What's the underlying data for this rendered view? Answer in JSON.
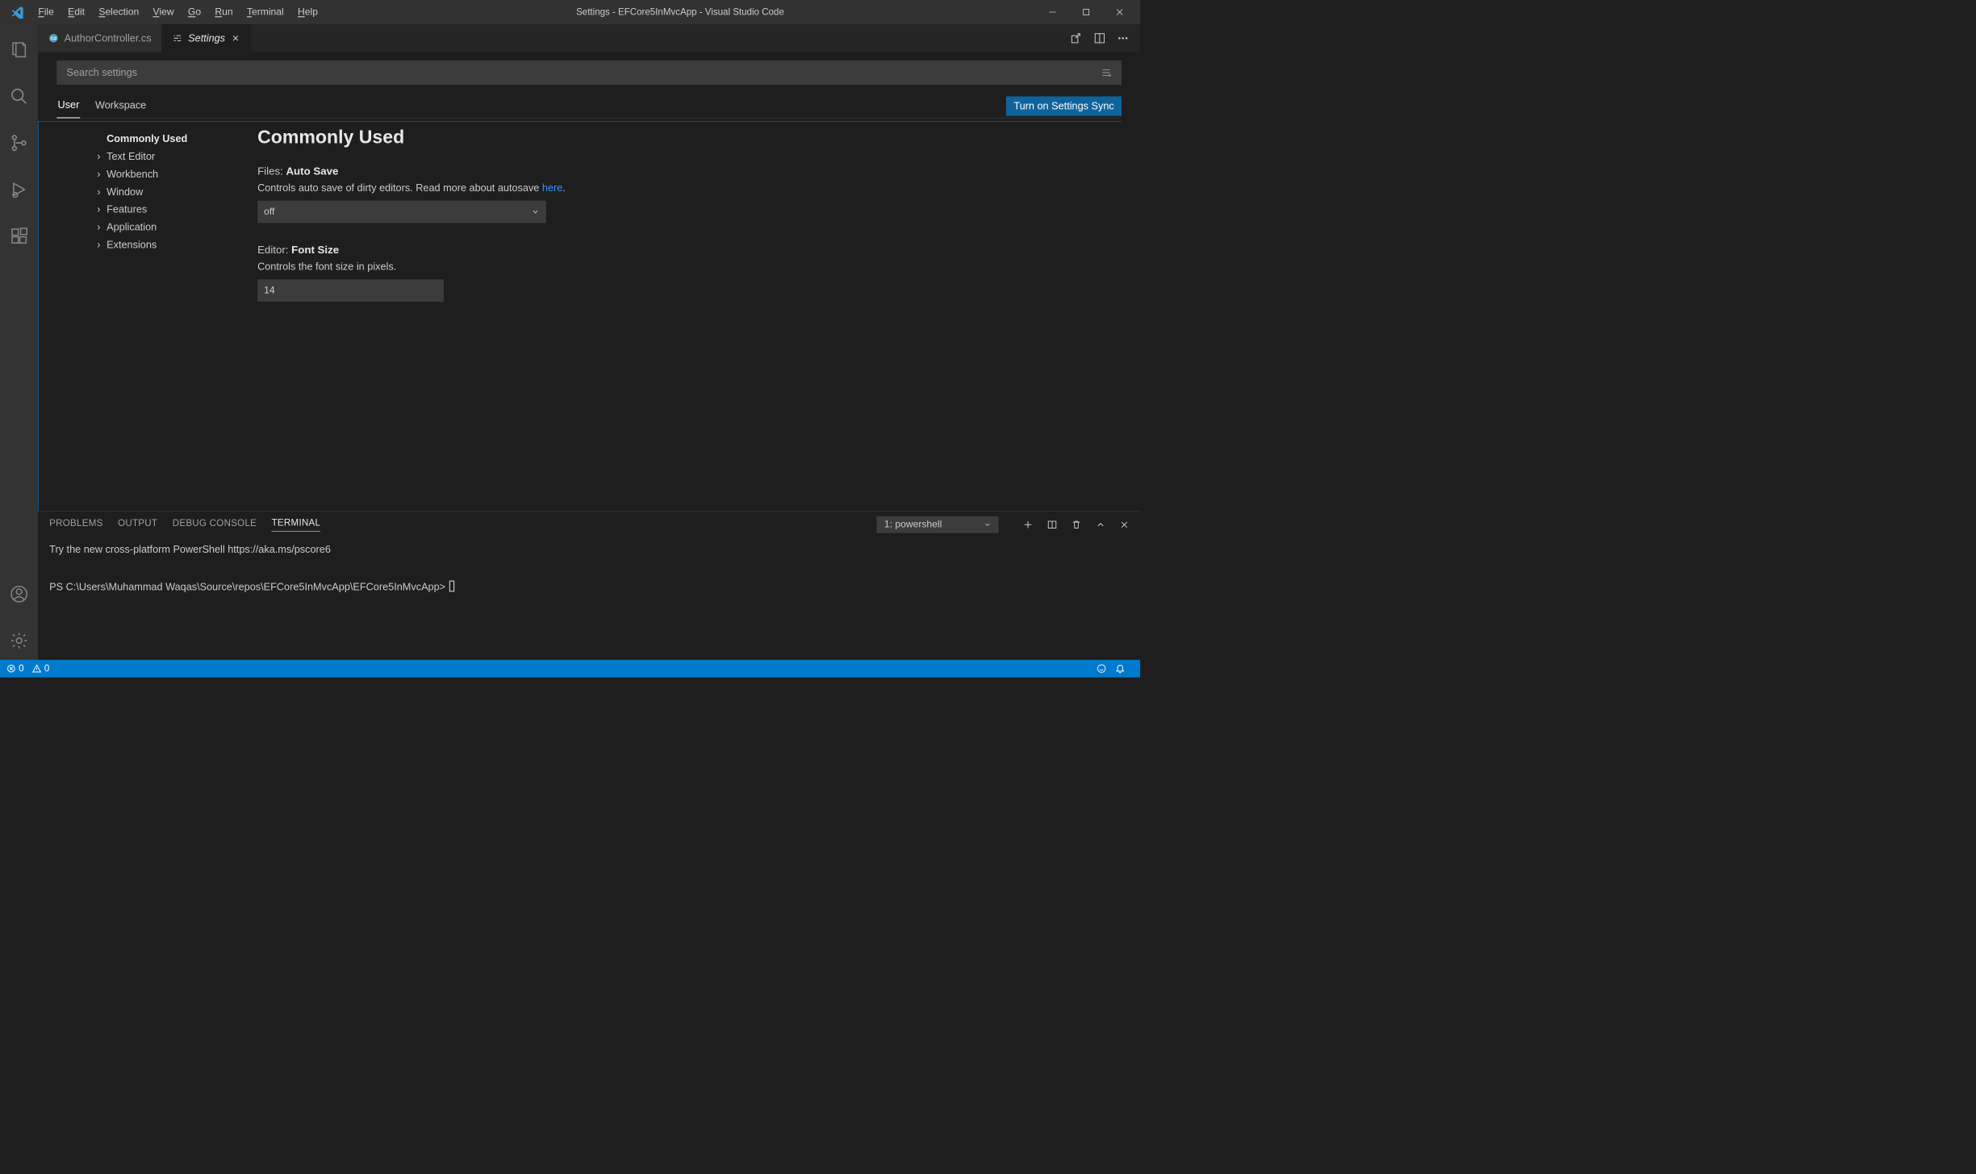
{
  "window": {
    "title": "Settings - EFCore5InMvcApp - Visual Studio Code"
  },
  "menu": {
    "file": "File",
    "edit": "Edit",
    "selection": "Selection",
    "view": "View",
    "go": "Go",
    "run": "Run",
    "terminal": "Terminal",
    "help": "Help"
  },
  "tabs": {
    "author": "AuthorController.cs",
    "settings": "Settings"
  },
  "search": {
    "placeholder": "Search settings"
  },
  "scope": {
    "user": "User",
    "workspace": "Workspace",
    "sync": "Turn on Settings Sync"
  },
  "toc": {
    "commonly_used": "Commonly Used",
    "text_editor": "Text Editor",
    "workbench": "Workbench",
    "window": "Window",
    "features": "Features",
    "application": "Application",
    "extensions": "Extensions"
  },
  "section": {
    "title": "Commonly Used"
  },
  "settings": {
    "autosave": {
      "cat": "Files: ",
      "name": "Auto Save",
      "desc_a": "Controls auto save of dirty editors. Read more about autosave ",
      "desc_link": "here",
      "desc_b": ".",
      "value": "off"
    },
    "fontsize": {
      "cat": "Editor: ",
      "name": "Font Size",
      "desc": "Controls the font size in pixels.",
      "value": "14"
    }
  },
  "panel": {
    "problems": "PROBLEMS",
    "output": "OUTPUT",
    "debug": "DEBUG CONSOLE",
    "terminal": "TERMINAL",
    "term_select": "1: powershell",
    "line1": "Try the new cross-platform PowerShell https://aka.ms/pscore6",
    "prompt": "PS C:\\Users\\Muhammad Waqas\\Source\\repos\\EFCore5InMvcApp\\EFCore5InMvcApp>"
  },
  "status": {
    "errors": "0",
    "warnings": "0"
  }
}
